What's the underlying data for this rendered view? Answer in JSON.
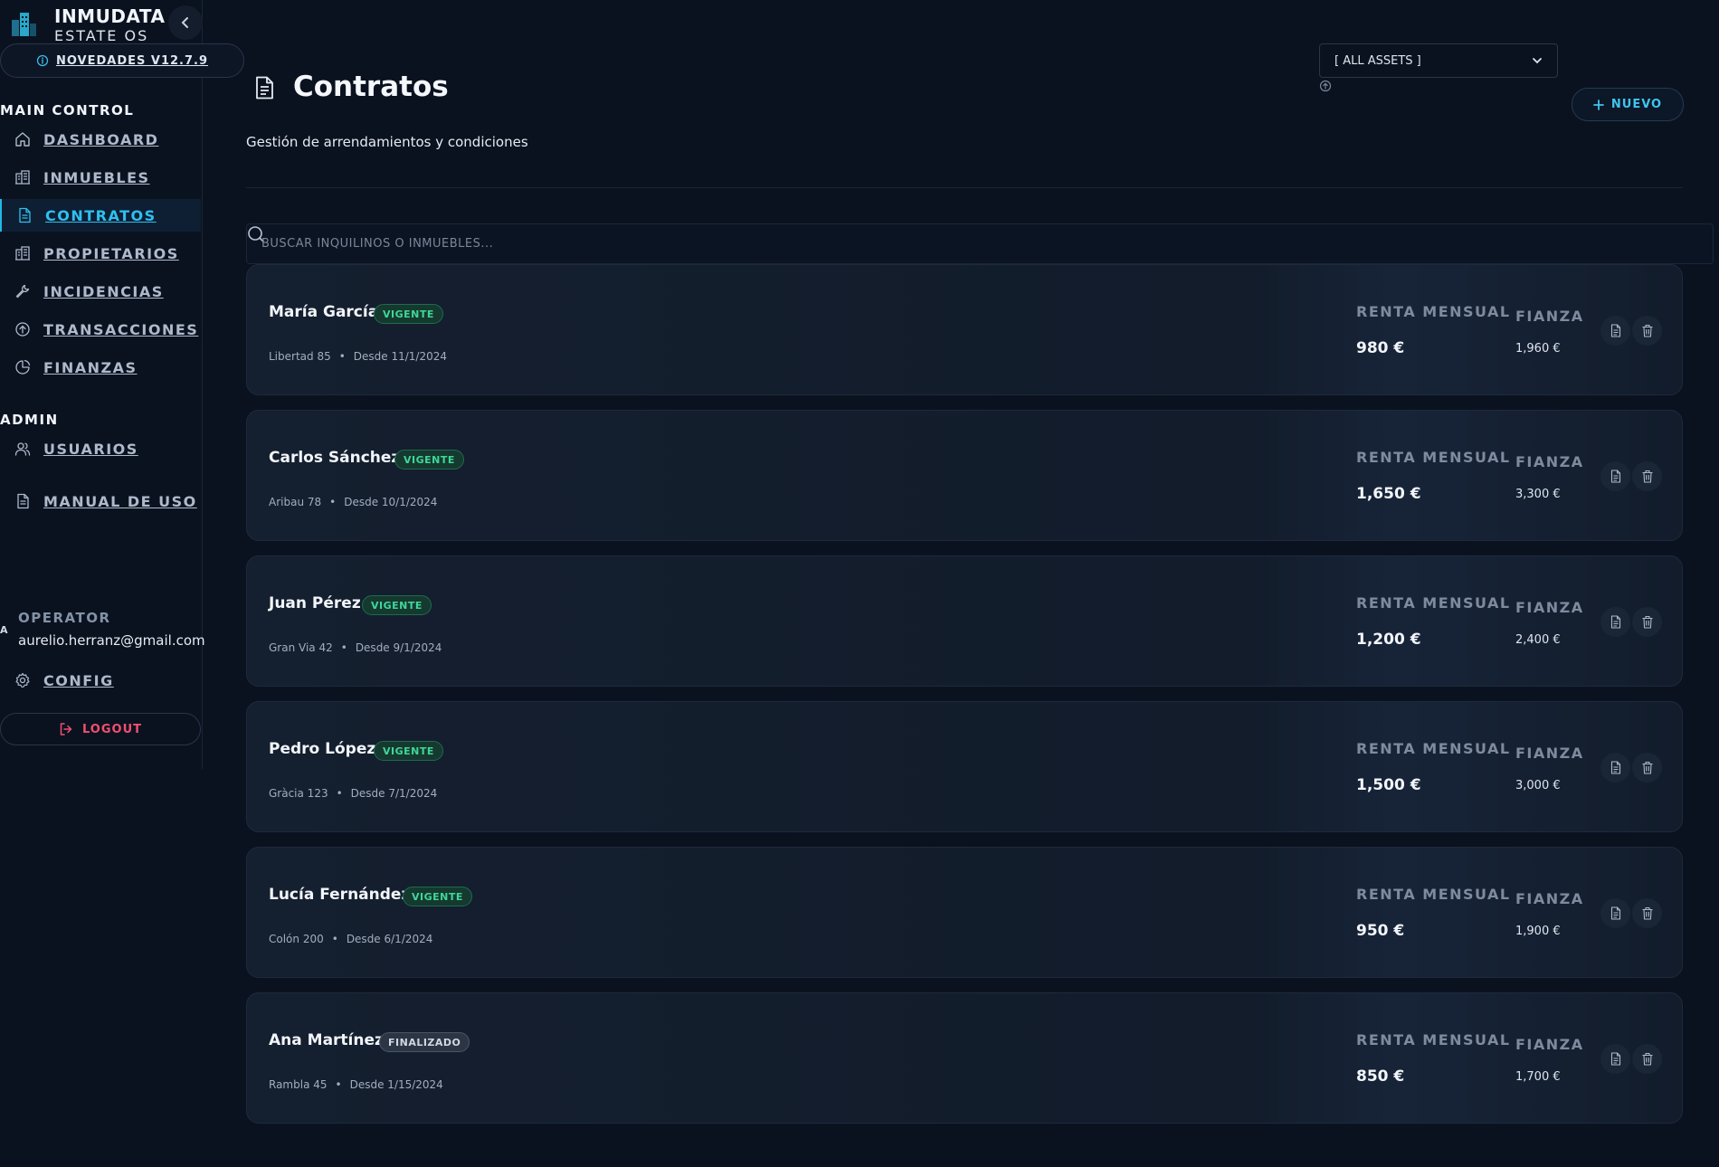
{
  "brand": {
    "title": "INMUDATA",
    "subtitle": "ESTATE OS"
  },
  "news": {
    "label": "NOVEDADES V12.7.9"
  },
  "sidebar": {
    "main_label": "MAIN CONTROL",
    "items": [
      {
        "label": "DASHBOARD",
        "icon": "home-icon"
      },
      {
        "label": "INMUEBLES",
        "icon": "building-icon"
      },
      {
        "label": "CONTRATOS",
        "icon": "document-icon",
        "active": true
      },
      {
        "label": "PROPIETARIOS",
        "icon": "building-icon"
      },
      {
        "label": "INCIDENCIAS",
        "icon": "wrench-icon"
      },
      {
        "label": "TRANSACCIONES",
        "icon": "arrow-up-circle-icon"
      },
      {
        "label": "FINANZAS",
        "icon": "pie-chart-icon"
      }
    ],
    "admin_label": "ADMIN",
    "admin_items": [
      {
        "label": "USUARIOS",
        "icon": "users-icon"
      }
    ],
    "manual": {
      "label": "MANUAL DE USO",
      "icon": "document-icon"
    }
  },
  "operator": {
    "avatar": "A",
    "role": "OPERATOR",
    "email": "aurelio.herranz@gmail.com"
  },
  "config": {
    "label": "CONFIG"
  },
  "logout": {
    "label": "LOGOUT"
  },
  "page": {
    "title": "Contratos",
    "subtitle": "Gestión de arrendamientos y condiciones"
  },
  "filter": {
    "selected": "[ ALL ASSETS ]"
  },
  "new_button": {
    "label": "NUEVO"
  },
  "search": {
    "placeholder": "BUSCAR INQUILINOS O INMUEBLES..."
  },
  "labels": {
    "rent": "RENTA MENSUAL",
    "deposit": "FIANZA"
  },
  "colors": {
    "accent": "#2fc0f0",
    "active_badge": "#3fd69a",
    "danger": "#f0506e",
    "background": "#0a1220"
  },
  "contracts": [
    {
      "tenant": "María García",
      "status": "VIGENTE",
      "address": "Libertad 85",
      "since": "Desde 11/1/2024",
      "rent": "980 €",
      "deposit": "1,960 €"
    },
    {
      "tenant": "Carlos Sánchez",
      "status": "VIGENTE",
      "address": "Aribau 78",
      "since": "Desde 10/1/2024",
      "rent": "1,650 €",
      "deposit": "3,300 €"
    },
    {
      "tenant": "Juan Pérez",
      "status": "VIGENTE",
      "address": "Gran Via 42",
      "since": "Desde 9/1/2024",
      "rent": "1,200 €",
      "deposit": "2,400 €"
    },
    {
      "tenant": "Pedro López",
      "status": "VIGENTE",
      "address": "Gràcia 123",
      "since": "Desde 7/1/2024",
      "rent": "1,500 €",
      "deposit": "3,000 €"
    },
    {
      "tenant": "Lucía Fernández",
      "status": "VIGENTE",
      "address": "Colón 200",
      "since": "Desde 6/1/2024",
      "rent": "950 €",
      "deposit": "1,900 €"
    },
    {
      "tenant": "Ana Martínez",
      "status": "FINALIZADO",
      "address": "Rambla 45",
      "since": "Desde 1/15/2024",
      "rent": "850 €",
      "deposit": "1,700 €"
    }
  ]
}
